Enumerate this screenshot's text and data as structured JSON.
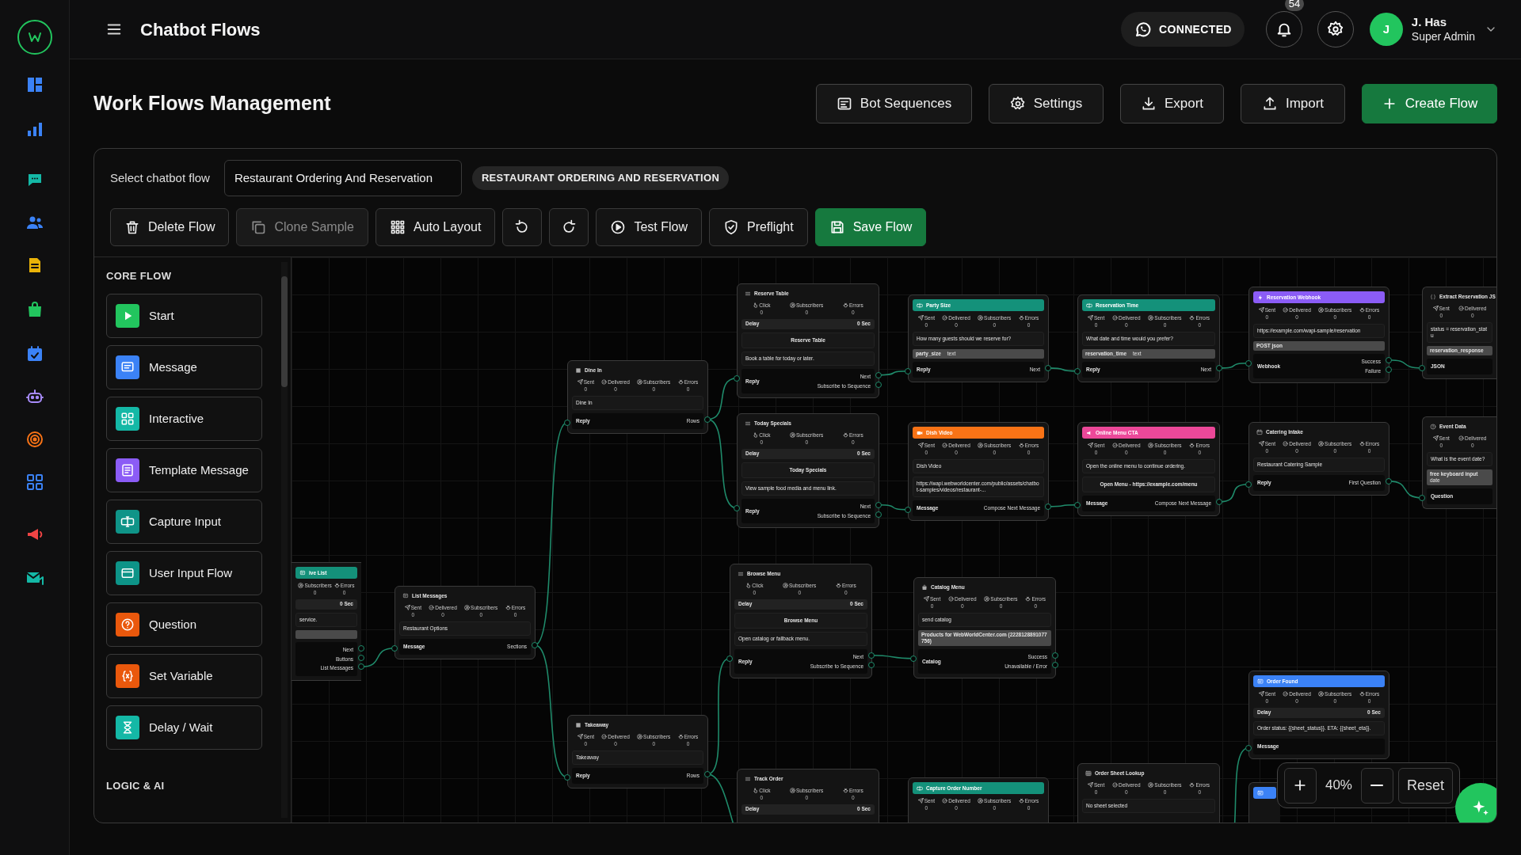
{
  "header": {
    "title": "Chatbot Flows",
    "connection": "CONNECTED",
    "notifications": "54",
    "user": {
      "initial": "J",
      "name": "J. Has",
      "role": "Super Admin"
    }
  },
  "page": {
    "title": "Work Flows Management",
    "actions": [
      {
        "kind": "sequences",
        "label": "Bot Sequences",
        "primary": false
      },
      {
        "kind": "settings",
        "label": "Settings",
        "primary": false
      },
      {
        "kind": "export",
        "label": "Export",
        "primary": false
      },
      {
        "kind": "import",
        "label": "Import",
        "primary": false
      },
      {
        "kind": "create",
        "label": "Create Flow",
        "primary": true
      }
    ]
  },
  "flow_select": {
    "label": "Select chatbot flow",
    "value": "Restaurant Ordering And Reservation",
    "badge": "RESTAURANT ORDERING AND RESERVATION"
  },
  "toolbar": [
    {
      "kind": "delete",
      "label": "Delete Flow",
      "disabled": false,
      "primary": false
    },
    {
      "kind": "clone",
      "label": "Clone Sample",
      "disabled": true,
      "primary": false
    },
    {
      "kind": "layout",
      "label": "Auto Layout",
      "disabled": false,
      "primary": false
    },
    {
      "kind": "undo",
      "disabled": false,
      "primary": false
    },
    {
      "kind": "redo",
      "disabled": false,
      "primary": false
    },
    {
      "kind": "test",
      "label": "Test Flow",
      "disabled": false,
      "primary": false
    },
    {
      "kind": "preflight",
      "label": "Preflight",
      "disabled": false,
      "primary": false
    },
    {
      "kind": "save",
      "label": "Save Flow",
      "disabled": false,
      "primary": true
    }
  ],
  "palette": {
    "sections": [
      {
        "title": "CORE FLOW",
        "items": [
          {
            "kind": "start",
            "label": "Start",
            "color": "#22c55e"
          },
          {
            "kind": "message",
            "label": "Message",
            "color": "#3b82f6"
          },
          {
            "kind": "interactive",
            "label": "Interactive",
            "color": "#14b8a6"
          },
          {
            "kind": "template",
            "label": "Template Message",
            "color": "#8b5cf6"
          },
          {
            "kind": "capture",
            "label": "Capture Input",
            "color": "#0f9488"
          },
          {
            "kind": "user-input",
            "label": "User Input Flow",
            "color": "#0d9488"
          },
          {
            "kind": "question",
            "label": "Question",
            "color": "#ea580c"
          },
          {
            "kind": "variable",
            "label": "Set Variable",
            "color": "#ea580c"
          },
          {
            "kind": "delay",
            "label": "Delay / Wait",
            "color": "#14b8a6"
          }
        ]
      },
      {
        "title": "LOGIC & AI"
      }
    ]
  },
  "nodes": [
    {
      "kind": "list",
      "title": "ive List",
      "color": "#14917a",
      "stats": [
        {
          "kind": "subscribers",
          "label": "Subscribers",
          "value": "0"
        },
        {
          "kind": "errors",
          "label": "Errors",
          "value": "0"
        }
      ],
      "rows": [
        {
          "kind": "delay",
          "value": "0 Sec"
        },
        {
          "kind": "text",
          "text": "service."
        },
        {
          "kind": "field"
        }
      ],
      "footer": {
        "outputs": [
          "Next",
          "Buttons",
          "List Messages"
        ]
      }
    },
    {
      "kind": "list",
      "title": "List Messages",
      "stats": [
        {
          "kind": "sent",
          "label": "Sent",
          "value": "0"
        },
        {
          "kind": "delivered",
          "label": "Delivered",
          "value": "0"
        },
        {
          "kind": "subscribers",
          "label": "Subscribers",
          "value": "0"
        },
        {
          "kind": "errors",
          "label": "Errors",
          "value": "0"
        }
      ],
      "rows": [
        {
          "kind": "text",
          "text": "Restaurant Options"
        }
      ],
      "footer": {
        "input": "Message",
        "outputs": [
          "Sections"
        ]
      }
    },
    {
      "kind": "grid",
      "title": "Dine In",
      "stats": [
        {
          "kind": "sent",
          "label": "Sent",
          "value": "0"
        },
        {
          "kind": "delivered",
          "label": "Delivered",
          "value": "0"
        },
        {
          "kind": "subscribers",
          "label": "Subscribers",
          "value": "0"
        },
        {
          "kind": "errors",
          "label": "Errors",
          "value": "0"
        }
      ],
      "rows": [
        {
          "kind": "text",
          "text": "Dine In"
        }
      ],
      "footer": {
        "input": "Reply",
        "outputs": [
          "Rows"
        ]
      }
    },
    {
      "kind": "grid",
      "title": "Takeaway",
      "stats": [
        {
          "kind": "sent",
          "label": "Sent",
          "value": "0"
        },
        {
          "kind": "delivered",
          "label": "Delivered",
          "value": "0"
        },
        {
          "kind": "subscribers",
          "label": "Subscribers",
          "value": "0"
        },
        {
          "kind": "errors",
          "label": "Errors",
          "value": "0"
        }
      ],
      "rows": [
        {
          "kind": "text",
          "text": "Takeaway"
        }
      ],
      "footer": {
        "input": "Reply",
        "outputs": [
          "Rows"
        ]
      }
    },
    {
      "kind": "menu",
      "title": "Reserve Table",
      "stats": [
        {
          "kind": "click",
          "label": "Click",
          "value": "0"
        },
        {
          "kind": "subscribers",
          "label": "Subscribers",
          "value": "0"
        },
        {
          "kind": "errors",
          "label": "Errors",
          "value": "0"
        }
      ],
      "rows": [
        {
          "kind": "delay",
          "label": "Delay",
          "value": "0 Sec"
        },
        {
          "kind": "heading",
          "text": "Reserve Table"
        },
        {
          "kind": "text",
          "text": "Book a table for today or later."
        }
      ],
      "footer": {
        "input": "Reply",
        "outputs": [
          "Next",
          "Subscribe to Sequence"
        ]
      }
    },
    {
      "kind": "menu",
      "title": "Today Specials",
      "stats": [
        {
          "kind": "click",
          "label": "Click",
          "value": "0"
        },
        {
          "kind": "subscribers",
          "label": "Subscribers",
          "value": "0"
        },
        {
          "kind": "errors",
          "label": "Errors",
          "value": "0"
        }
      ],
      "rows": [
        {
          "kind": "delay",
          "label": "Delay",
          "value": "0 Sec"
        },
        {
          "kind": "heading",
          "text": "Today Specials"
        },
        {
          "kind": "text",
          "text": "View sample food media and menu link."
        }
      ],
      "footer": {
        "input": "Reply",
        "outputs": [
          "Next",
          "Subscribe to Sequence"
        ]
      }
    },
    {
      "kind": "menu",
      "title": "Browse Menu",
      "stats": [
        {
          "kind": "click",
          "label": "Click",
          "value": "0"
        },
        {
          "kind": "subscribers",
          "label": "Subscribers",
          "value": "0"
        },
        {
          "kind": "errors",
          "label": "Errors",
          "value": "0"
        }
      ],
      "rows": [
        {
          "kind": "delay",
          "label": "Delay",
          "value": "0 Sec"
        },
        {
          "kind": "heading",
          "text": "Browse Menu"
        },
        {
          "kind": "text",
          "text": "Open catalog or fallback menu."
        }
      ],
      "footer": {
        "input": "Reply",
        "outputs": [
          "Next",
          "Subscribe to Sequence"
        ]
      }
    },
    {
      "kind": "menu",
      "title": "Track Order",
      "stats": [
        {
          "kind": "click",
          "label": "Click",
          "value": "0"
        },
        {
          "kind": "subscribers",
          "label": "Subscribers",
          "value": "0"
        },
        {
          "kind": "errors",
          "label": "Errors",
          "value": "0"
        }
      ],
      "rows": [
        {
          "kind": "delay",
          "label": "Delay",
          "value": "0 Sec"
        }
      ]
    },
    {
      "kind": "input",
      "title": "Party Size",
      "color": "#14917a",
      "stats": [
        {
          "kind": "sent",
          "label": "Sent",
          "value": "0"
        },
        {
          "kind": "delivered",
          "label": "Delivered",
          "value": "0"
        },
        {
          "kind": "subscribers",
          "label": "Subscribers",
          "value": "0"
        },
        {
          "kind": "errors",
          "label": "Errors",
          "value": "0"
        }
      ],
      "rows": [
        {
          "kind": "text",
          "text": "How many guests should we reserve for?"
        },
        {
          "kind": "field",
          "text": "party_size",
          "type": "text"
        }
      ],
      "footer": {
        "input": "Reply",
        "outputs": [
          "Next"
        ]
      }
    },
    {
      "kind": "media",
      "title": "Dish Video",
      "color": "#f97316",
      "stats": [
        {
          "kind": "sent",
          "label": "Sent",
          "value": "0"
        },
        {
          "kind": "delivered",
          "label": "Delivered",
          "value": "0"
        },
        {
          "kind": "subscribers",
          "label": "Subscribers",
          "value": "0"
        },
        {
          "kind": "errors",
          "label": "Errors",
          "value": "0"
        }
      ],
      "rows": [
        {
          "kind": "text",
          "text": "Dish Video"
        },
        {
          "kind": "text",
          "text": "https://wapi.webworldcenter.com/public/assets/chatbot-samples/videos/restaurant-..."
        }
      ],
      "footer": {
        "input": "Message",
        "outputs": [
          "Compose Next Message"
        ]
      }
    },
    {
      "kind": "catalog",
      "title": "Catalog Menu",
      "stats": [
        {
          "kind": "sent",
          "label": "Sent",
          "value": "0"
        },
        {
          "kind": "delivered",
          "label": "Delivered",
          "value": "0"
        },
        {
          "kind": "subscribers",
          "label": "Subscribers",
          "value": "0"
        },
        {
          "kind": "errors",
          "label": "Errors",
          "value": "0"
        }
      ],
      "rows": [
        {
          "kind": "text",
          "text": "send catalog"
        },
        {
          "kind": "field",
          "text": "Products for WebWorldCenter.com (2228128891077756)"
        }
      ],
      "footer": {
        "input": "Catalog",
        "outputs": [
          "Success",
          "Unavailable / Error"
        ]
      }
    },
    {
      "kind": "input",
      "title": "Capture Order Number",
      "color": "#14917a",
      "stats": [
        {
          "kind": "sent",
          "label": "Sent",
          "value": "0"
        },
        {
          "kind": "delivered",
          "label": "Delivered",
          "value": "0"
        },
        {
          "kind": "subscribers",
          "label": "Subscribers",
          "value": "0"
        },
        {
          "kind": "errors",
          "label": "Errors",
          "value": "0"
        }
      ]
    },
    {
      "kind": "input",
      "title": "Reservation Time",
      "color": "#14917a",
      "stats": [
        {
          "kind": "sent",
          "label": "Sent",
          "value": "0"
        },
        {
          "kind": "delivered",
          "label": "Delivered",
          "value": "0"
        },
        {
          "kind": "subscribers",
          "label": "Subscribers",
          "value": "0"
        },
        {
          "kind": "errors",
          "label": "Errors",
          "value": "0"
        }
      ],
      "rows": [
        {
          "kind": "text",
          "text": "What date and time would you prefer?"
        },
        {
          "kind": "field",
          "text": "reservation_time",
          "type": "text"
        }
      ],
      "footer": {
        "input": "Reply",
        "outputs": [
          "Next"
        ]
      }
    },
    {
      "kind": "cta",
      "title": "Online Menu CTA",
      "color": "#ec4899",
      "stats": [
        {
          "kind": "sent",
          "label": "Sent",
          "value": "0"
        },
        {
          "kind": "delivered",
          "label": "Delivered",
          "value": "0"
        },
        {
          "kind": "subscribers",
          "label": "Subscribers",
          "value": "0"
        },
        {
          "kind": "errors",
          "label": "Errors",
          "value": "0"
        }
      ],
      "rows": [
        {
          "kind": "text",
          "text": "Open the online menu to continue ordering."
        },
        {
          "kind": "heading",
          "text": "Open Menu - https://example.com/menu"
        }
      ],
      "footer": {
        "input": "Message",
        "outputs": [
          "Compose Next Message"
        ]
      }
    },
    {
      "kind": "sheet",
      "title": "Order Sheet Lookup",
      "stats": [
        {
          "kind": "sent",
          "label": "Sent",
          "value": "0"
        },
        {
          "kind": "delivered",
          "label": "Delivered",
          "value": "0"
        },
        {
          "kind": "subscribers",
          "label": "Subscribers",
          "value": "0"
        },
        {
          "kind": "errors",
          "label": "Errors",
          "value": "0"
        }
      ],
      "rows": [
        {
          "kind": "text",
          "text": "No sheet selected"
        }
      ]
    },
    {
      "kind": "webhook",
      "title": "Reservation Webhook",
      "color": "#8b5cf6",
      "stats": [
        {
          "kind": "sent",
          "label": "Sent",
          "value": "0"
        },
        {
          "kind": "delivered",
          "label": "Delivered",
          "value": "0"
        },
        {
          "kind": "subscribers",
          "label": "Subscribers",
          "value": "0"
        },
        {
          "kind": "errors",
          "label": "Errors",
          "value": "0"
        }
      ],
      "rows": [
        {
          "kind": "text",
          "text": "https://example.com/wapi-sample/reservation"
        },
        {
          "kind": "field",
          "text": "POST json"
        }
      ],
      "footer": {
        "input": "Webhook",
        "outputs": [
          "Success",
          "Failure"
        ]
      }
    },
    {
      "kind": "form",
      "title": "Catering Intake",
      "stats": [
        {
          "kind": "sent",
          "label": "Sent",
          "value": "0"
        },
        {
          "kind": "delivered",
          "label": "Delivered",
          "value": "0"
        },
        {
          "kind": "subscribers",
          "label": "Subscribers",
          "value": "0"
        },
        {
          "kind": "errors",
          "label": "Errors",
          "value": "0"
        }
      ],
      "rows": [
        {
          "kind": "text",
          "text": "Restaurant Catering Sample"
        }
      ],
      "footer": {
        "input": "Reply",
        "outputs": [
          "First Question"
        ]
      }
    },
    {
      "kind": "message",
      "title": "Order Found",
      "color": "#3b82f6",
      "stats": [
        {
          "kind": "sent",
          "label": "Sent",
          "value": "0"
        },
        {
          "kind": "delivered",
          "label": "Delivered",
          "value": "0"
        },
        {
          "kind": "subscribers",
          "label": "Subscribers",
          "value": "0"
        },
        {
          "kind": "errors",
          "label": "Errors",
          "value": "0"
        }
      ],
      "rows": [
        {
          "kind": "delay",
          "label": "Delay",
          "value": "0 Sec"
        },
        {
          "kind": "text",
          "text": "Order status: {{sheet_status}}. ETA: {{sheet_eta}}."
        }
      ],
      "footer": {
        "input": "Message"
      }
    },
    {
      "kind": "message",
      "color": "#3b82f6"
    },
    {
      "kind": "json",
      "title": "Extract Reservation JS",
      "stats": [
        {
          "kind": "sent",
          "label": "Sent",
          "value": "0"
        },
        {
          "kind": "delivered",
          "label": "Delivered",
          "value": "0"
        }
      ],
      "rows": [
        {
          "kind": "text",
          "text": "status = reservation_statu"
        },
        {
          "kind": "field",
          "text": "reservation_response"
        }
      ],
      "footer": {
        "input": "JSON"
      }
    },
    {
      "kind": "question",
      "title": "Event Data",
      "stats": [
        {
          "kind": "sent",
          "label": "Sent",
          "value": "0"
        },
        {
          "kind": "delivered",
          "label": "Delivered",
          "value": "0"
        }
      ],
      "rows": [
        {
          "kind": "text",
          "text": "What is the event date?"
        },
        {
          "kind": "field",
          "text": "free keyboard input",
          "type": "date"
        }
      ],
      "footer": {
        "input": "Question"
      }
    }
  ],
  "zoom": {
    "level": "40%",
    "reset": "Reset"
  }
}
